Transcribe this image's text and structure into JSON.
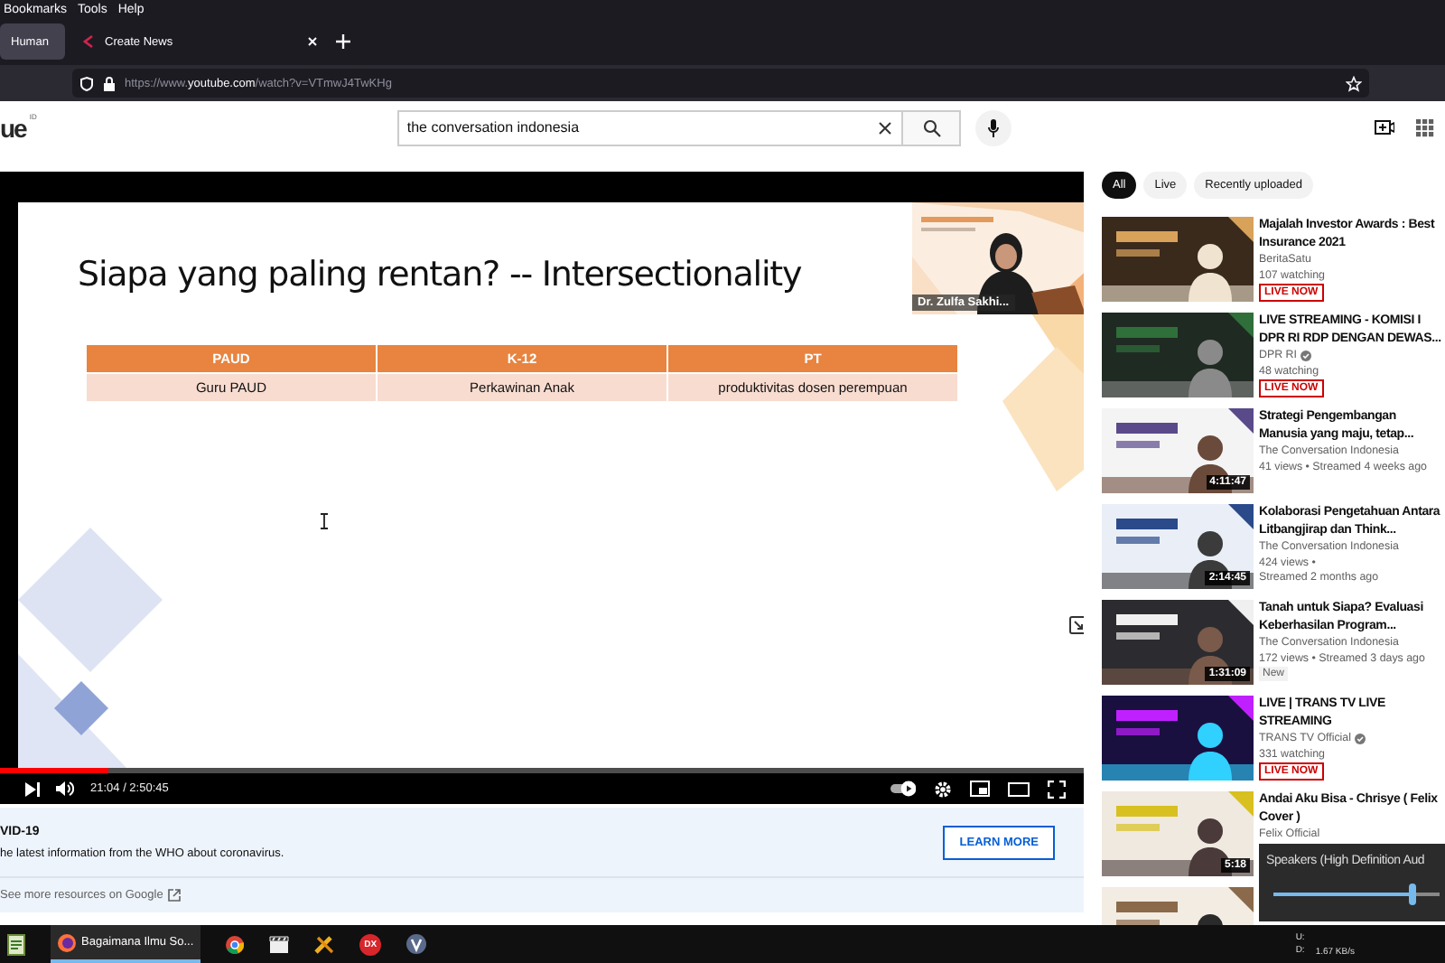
{
  "menu": [
    "Bookmarks",
    "Tools",
    "Help"
  ],
  "tabs": [
    {
      "label": "Human",
      "selected": true
    },
    {
      "label": "Create News",
      "selected": false
    }
  ],
  "address_bar": {
    "url_parts": [
      "https://www.",
      "youtube.com",
      "/watch?v=VTmwJ4TwKHg"
    ]
  },
  "youtube_header": {
    "logo": "ue",
    "logo_region": "ID",
    "search": {
      "value": "the conversation indonesia"
    }
  },
  "player": {
    "slide": {
      "title": "Siapa yang paling rentan? -- Intersectionality",
      "table": {
        "columns": [
          "PAUD",
          "K-12",
          "PT"
        ],
        "rows": [
          [
            "Guru PAUD",
            "Perkawinan Anak",
            "produktivitas dosen perempuan"
          ]
        ]
      }
    },
    "speaker": "Dr. Zulfa Sakhi...",
    "level": 0.1,
    "time": "21:04 / 2:50:45",
    "autoplay": true
  },
  "covid_banner": {
    "title": "VID-19",
    "text": "he latest information from the WHO about coronavirus.",
    "link": "See more resources on Google",
    "button": "LEARN MORE"
  },
  "chips": [
    {
      "label": "All",
      "selected": true
    },
    {
      "label": "Live",
      "selected": false
    },
    {
      "label": "Recently uploaded",
      "selected": false
    }
  ],
  "videos": [
    {
      "kind": "video",
      "title": "Majalah Investor Awards : Best Insurance 2021",
      "channel": "BeritaSatu",
      "verified": false,
      "meta": [
        "107 watching"
      ],
      "badge": {
        "kind": "live",
        "label": "LIVE NOW"
      }
    },
    {
      "kind": "video",
      "title": "LIVE STREAMING - KOMISI I DPR RI RDP DENGAN DEWAS...",
      "channel": "DPR RI",
      "verified": true,
      "meta": [
        "48 watching"
      ],
      "badge": {
        "kind": "live",
        "label": "LIVE NOW"
      }
    },
    {
      "kind": "video",
      "title": "Strategi Pengembangan Manusia yang maju, tetap...",
      "channel": "The Conversation Indonesia",
      "verified": false,
      "meta": [
        "41 views • Streamed 4 weeks ago"
      ],
      "duration": "4:11:47"
    },
    {
      "kind": "video",
      "title": "Kolaborasi Pengetahuan Antara Litbangjirap dan Think...",
      "channel": "The Conversation Indonesia",
      "verified": false,
      "meta": [
        "424 views •",
        "Streamed 2 months ago"
      ],
      "duration": "2:14:45"
    },
    {
      "kind": "video",
      "title": "Tanah untuk Siapa? Evaluasi Keberhasilan Program...",
      "channel": "The Conversation Indonesia",
      "verified": false,
      "meta": [
        "172 views • Streamed 3 days ago"
      ],
      "duration": "1:31:09",
      "badge": {
        "kind": "new",
        "label": "New"
      }
    },
    {
      "kind": "video",
      "title": "LIVE | TRANS TV LIVE STREAMING",
      "channel": "TRANS TV Official",
      "verified": true,
      "meta": [
        "331 watching"
      ],
      "badge": {
        "kind": "live",
        "label": "LIVE NOW"
      }
    },
    {
      "kind": "video",
      "title": "Andai Aku Bisa - Chrisye ( Felix Cover )",
      "channel": "Felix Official",
      "verified": false,
      "duration": "5:18"
    },
    {
      "kind": "thumbnail_only"
    }
  ],
  "volume_popup": {
    "device": "Speakers (High Definition Aud",
    "level": 0.85
  },
  "taskbar": {
    "active_window": {
      "title": "Bagaimana Ilmu So...",
      "selected": true
    },
    "dx_label": "DX",
    "net": [
      "U:",
      "D:"
    ],
    "down_rate": "1.67 KB/s"
  }
}
